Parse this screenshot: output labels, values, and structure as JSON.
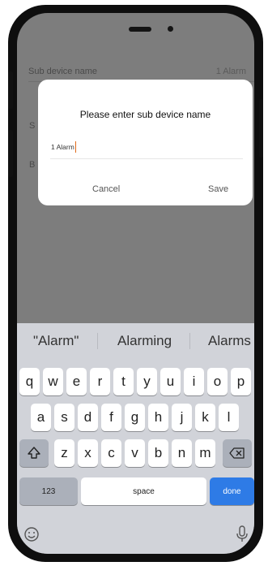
{
  "background": {
    "row1_label": "Sub device name",
    "row1_value": "1 Alarm",
    "row2_label": "S",
    "row3_label": "B"
  },
  "dialog": {
    "title": "Please enter sub device name",
    "input_value": "1 Alarm",
    "cancel_label": "Cancel",
    "save_label": "Save"
  },
  "keyboard": {
    "suggestions": [
      "\"Alarm\"",
      "Alarming",
      "Alarms"
    ],
    "row1": [
      "q",
      "w",
      "e",
      "r",
      "t",
      "y",
      "u",
      "i",
      "o",
      "p"
    ],
    "row2": [
      "a",
      "s",
      "d",
      "f",
      "g",
      "h",
      "j",
      "k",
      "l"
    ],
    "row3": [
      "z",
      "x",
      "c",
      "v",
      "b",
      "n",
      "m"
    ],
    "numbers_label": "123",
    "space_label": "space",
    "done_label": "done"
  },
  "icons": {
    "shift": "shift-icon",
    "backspace": "backspace-icon",
    "emoji": "emoji-icon",
    "mic": "microphone-icon"
  },
  "colors": {
    "dim_overlay": "#7d7d7d",
    "done_key": "#2e7be6",
    "caret": "#e06a1a",
    "keyboard_bg": "#d1d3d9"
  }
}
